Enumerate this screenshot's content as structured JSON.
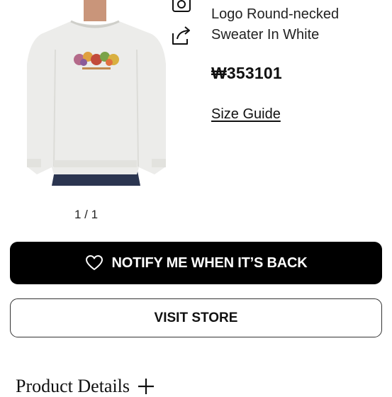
{
  "product": {
    "title_line1": "Logo Round-necked",
    "title_line2": "Sweater In White",
    "price": "₩353101",
    "size_guide": "Size Guide",
    "image_alt_icon": "sweater-photo"
  },
  "gallery": {
    "pager": "1 / 1"
  },
  "actions": {
    "notify_label": "NOTIFY ME WHEN IT’S BACK",
    "notify_icon": "heart-icon",
    "visit_label": "VISIT STORE",
    "camera_icon": "camera-icon",
    "share_icon": "share-icon"
  },
  "details": {
    "label": "Product Details",
    "icon": "plus-icon"
  },
  "colors": {
    "primary": "#000000",
    "background": "#ffffff",
    "sweater": "#ececea",
    "jeans": "#2b3550"
  }
}
